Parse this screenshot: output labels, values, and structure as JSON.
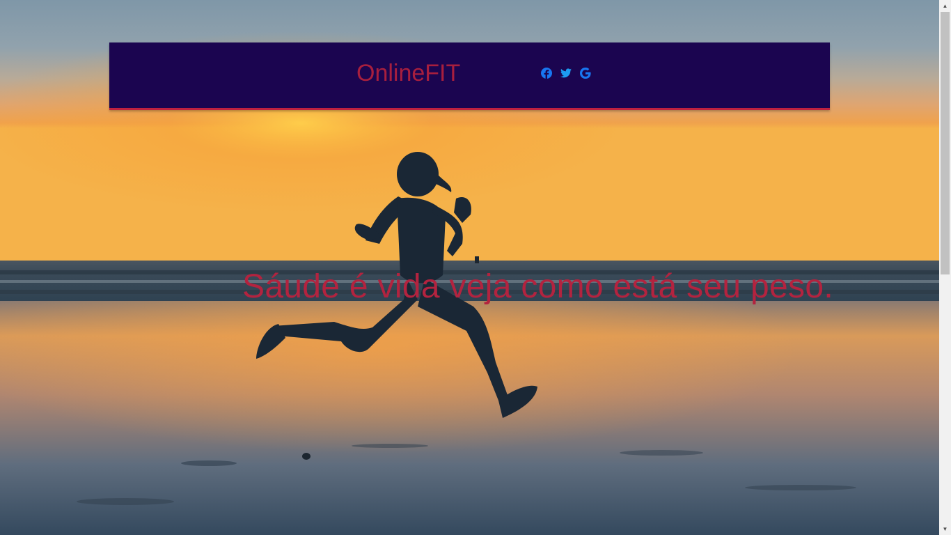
{
  "header": {
    "brand": "OnlineFIT",
    "social": [
      {
        "icon": "facebook-icon",
        "label": "Facebook"
      },
      {
        "icon": "twitter-icon",
        "label": "Twitter"
      },
      {
        "icon": "google-icon",
        "label": "Google"
      }
    ]
  },
  "hero": {
    "tagline": "Sáude é vida veja como está seu peso."
  },
  "colors": {
    "header_bg": "#1b0550",
    "brand_text": "#a81f3e",
    "accent_border": "#c0213f",
    "social_icons": "#1877f2",
    "tagline_text": "#b3233f",
    "sky_top": "#8fa3b3",
    "sun": "#f39a2b",
    "sea": "#2a3a4a"
  },
  "scrollbar": {
    "up_arrow": "▲",
    "down_arrow": "▼"
  }
}
